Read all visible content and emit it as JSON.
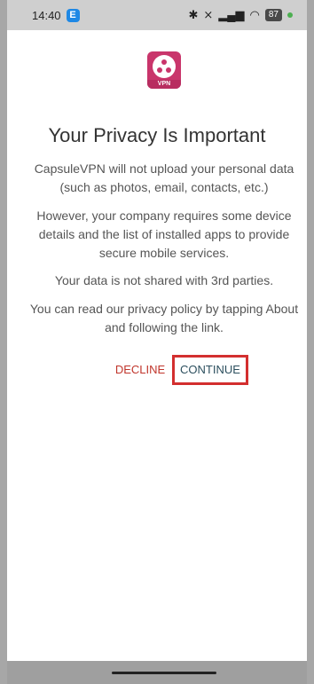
{
  "status_bar": {
    "time": "14:40",
    "carrier_badge": "E",
    "battery": "87",
    "icons": [
      "bluetooth-icon",
      "no-signal-icon",
      "signal-icon",
      "wifi-icon",
      "battery-icon"
    ]
  },
  "app": {
    "logo_label": "VPN",
    "title": "Your Privacy Is Important",
    "paragraphs": [
      "CapsuleVPN will not upload your personal data (such as photos, email, contacts, etc.)",
      "However, your company requires some device details and the list of installed apps to provide secure mobile services.",
      "Your data is not shared with 3rd parties.",
      "You can read our privacy policy by tapping About and following the link."
    ],
    "decline_label": "DECLINE",
    "continue_label": "CONTINUE"
  },
  "colors": {
    "accent_red": "#d32f2f",
    "decline_text": "#c0352b",
    "continue_text": "#2c4f5e",
    "logo_pink": "#c9356b"
  }
}
